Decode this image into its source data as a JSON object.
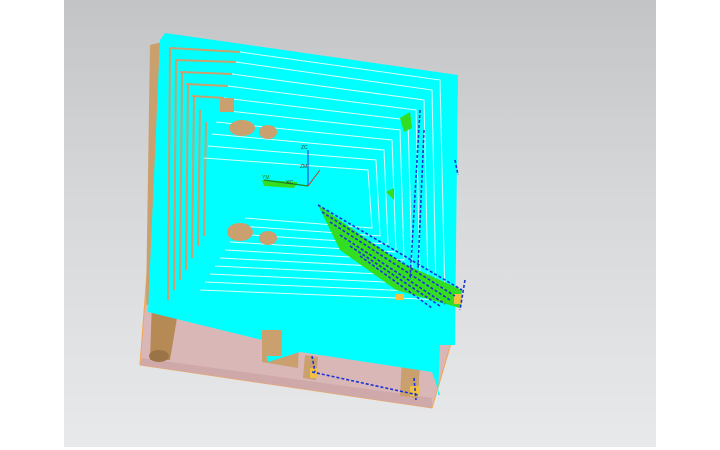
{
  "viewport": {
    "background_top": "#c3c4c6",
    "background_bottom": "#e8e9ea"
  },
  "model": {
    "top_face_color": "#00ffff",
    "side_face_color": "#d9b7b7",
    "pocket_wall_color": "#c9a06e",
    "edge_highlight_color": "#f2a552",
    "toolpath_color": "#1a33d9",
    "remaining_material_color": "#33dd22"
  },
  "wcs": {
    "x_label": "XC",
    "y_label": "YC",
    "z_label": "ZC",
    "alt_y_label": "YM",
    "alt_z_label": "ZM",
    "icon": "wcs-triad-icon"
  }
}
